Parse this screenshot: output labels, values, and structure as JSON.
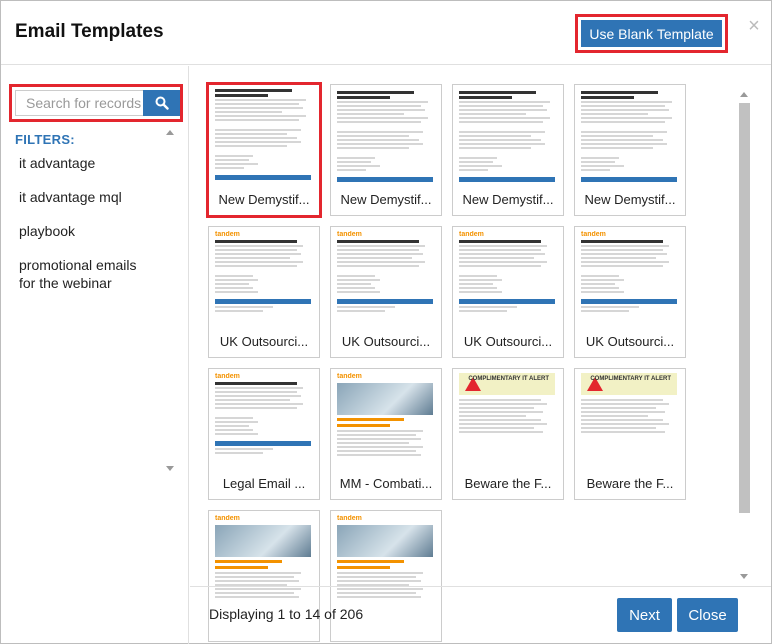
{
  "header": {
    "title": "Email Templates",
    "blank_template_label": "Use Blank Template",
    "close_glyph": "×"
  },
  "search": {
    "placeholder": "Search for records",
    "icon": "search-icon"
  },
  "filters": {
    "label": "FILTERS:",
    "items": [
      "it advantage",
      "it advantage mql",
      "playbook",
      "promotional emails for the webinar"
    ]
  },
  "templates": [
    {
      "label": "New Demystif...",
      "style": "blue-bar",
      "selected": true
    },
    {
      "label": "New Demystif...",
      "style": "blue-bar"
    },
    {
      "label": "New Demystif...",
      "style": "blue-bar"
    },
    {
      "label": "New Demystif...",
      "style": "blue-bar"
    },
    {
      "label": "UK Outsourci...",
      "style": "logo-bar"
    },
    {
      "label": "UK Outsourci...",
      "style": "logo-bar"
    },
    {
      "label": "UK Outsourci...",
      "style": "logo-bar"
    },
    {
      "label": "UK Outsourci...",
      "style": "logo-bar"
    },
    {
      "label": "Legal Email ...",
      "style": "logo-bar"
    },
    {
      "label": "MM - Combati...",
      "style": "photo"
    },
    {
      "label": "Beware the F...",
      "style": "alert",
      "alert_text": "COMPLIMENTARY IT ALERT"
    },
    {
      "label": "Beware the F...",
      "style": "alert",
      "alert_text": "COMPLIMENTARY IT ALERT"
    },
    {
      "label": "",
      "style": "photo"
    },
    {
      "label": "",
      "style": "photo"
    }
  ],
  "thumb_logo_text": "tandem",
  "footer": {
    "status": "Displaying 1 to 14 of 206",
    "next_label": "Next",
    "close_label": "Close"
  },
  "colors": {
    "accent": "#2f74b5",
    "highlight": "#e3262e"
  }
}
